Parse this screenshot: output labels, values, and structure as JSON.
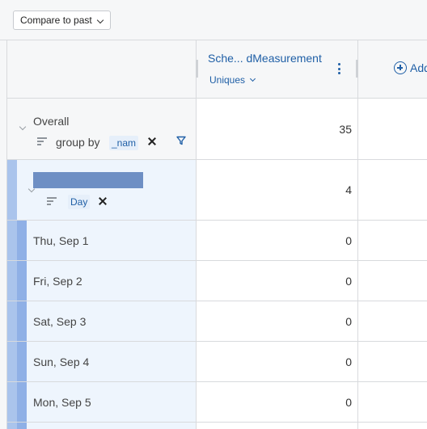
{
  "toolbar": {
    "compare_label": "Compare to past"
  },
  "header": {
    "metric_name": "Sche... dMeasurement",
    "metric_kind": "Uniques",
    "add_label": "Add"
  },
  "overall": {
    "label": "Overall",
    "group_by_label": "group by",
    "group_chip": "_nam",
    "value": "35"
  },
  "group": {
    "chip": "Day",
    "value": "4"
  },
  "rows": [
    {
      "label": "Thu, Sep 1",
      "value": "0"
    },
    {
      "label": "Fri, Sep 2",
      "value": "0"
    },
    {
      "label": "Sat, Sep 3",
      "value": "0"
    },
    {
      "label": "Sun, Sep 4",
      "value": "0"
    },
    {
      "label": "Mon, Sep 5",
      "value": "0"
    }
  ],
  "colors": {
    "accent": "#1f5fa6",
    "row_highlight": "#eef5fd",
    "level_bar": "#aac4ec",
    "level_bar_2": "#8fb0e6",
    "redaction": "#6e8fc4"
  }
}
